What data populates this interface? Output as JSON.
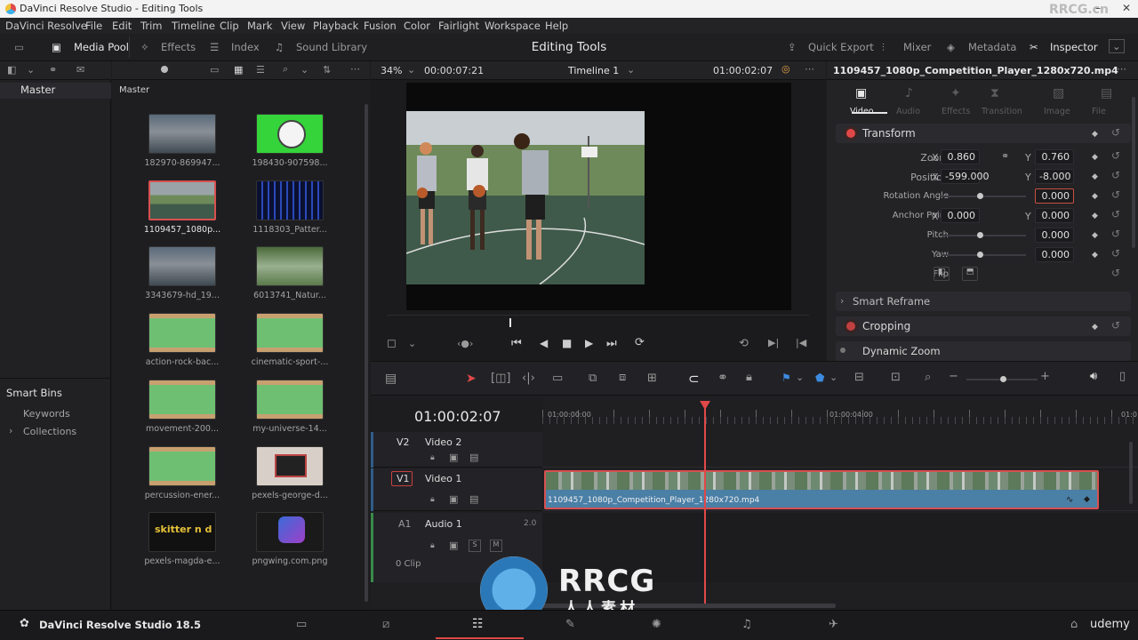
{
  "window": {
    "title": "DaVinci Resolve Studio - Editing Tools",
    "watermark": "RRCG.cn"
  },
  "menu": [
    "DaVinci Resolve",
    "File",
    "Edit",
    "Trim",
    "Timeline",
    "Clip",
    "Mark",
    "View",
    "Playback",
    "Fusion",
    "Color",
    "Fairlight",
    "Workspace",
    "Help"
  ],
  "toolbar": {
    "media_pool": "Media Pool",
    "effects": "Effects",
    "index": "Index",
    "sound_library": "Sound Library",
    "page_title": "Editing Tools",
    "quick_export": "Quick Export",
    "mixer": "Mixer",
    "metadata": "Metadata",
    "inspector": "Inspector"
  },
  "bins": {
    "master": "Master",
    "smart_bins": "Smart Bins",
    "keywords": "Keywords",
    "collections": "Collections"
  },
  "pool": {
    "header": "Master",
    "clips": [
      {
        "name": "182970-869947...",
        "kind": "video"
      },
      {
        "name": "198430-907598...",
        "kind": "green"
      },
      {
        "name": "1109457_1080p...",
        "kind": "selected"
      },
      {
        "name": "1118303_Patter...",
        "kind": "blue"
      },
      {
        "name": "3343679-hd_19...",
        "kind": "video"
      },
      {
        "name": "6013741_Natur...",
        "kind": "nature"
      },
      {
        "name": "action-rock-bac...",
        "kind": "audio"
      },
      {
        "name": "cinematic-sport-...",
        "kind": "audio"
      },
      {
        "name": "movement-200...",
        "kind": "audio"
      },
      {
        "name": "my-universe-14...",
        "kind": "audio"
      },
      {
        "name": "percussion-ener...",
        "kind": "audio"
      },
      {
        "name": "pexels-george-d...",
        "kind": "image"
      },
      {
        "name": "pexels-magda-e...",
        "kind": "dark"
      },
      {
        "name": "pngwing.com.png",
        "kind": "resolve"
      }
    ],
    "thumb_text": "skitter n d"
  },
  "viewer": {
    "zoom": "34%",
    "source_tc": "00:00:07:21",
    "timeline_name": "Timeline 1",
    "record_tc": "01:00:02:07"
  },
  "inspector": {
    "clip_name": "1109457_1080p_Competition_Player_1280x720.mp4",
    "tabs": [
      "Video",
      "Audio",
      "Effects",
      "Transition",
      "Image",
      "File"
    ],
    "transform": "Transform",
    "zoom_label": "Zoom",
    "zoom_x": "0.860",
    "zoom_y": "0.760",
    "position_label": "Position",
    "pos_x": "-599.000",
    "pos_y": "-8.000",
    "rotation_label": "Rotation Angle",
    "rotation": "0.000",
    "anchor_label": "Anchor Point",
    "anchor_x": "0.000",
    "anchor_y": "0.000",
    "pitch_label": "Pitch",
    "pitch": "0.000",
    "yaw_label": "Yaw",
    "yaw": "0.000",
    "flip_label": "Flip",
    "x": "X",
    "y": "Y",
    "smart_reframe": "Smart Reframe",
    "cropping": "Cropping",
    "dynamic_zoom": "Dynamic Zoom"
  },
  "timeline": {
    "timecode": "01:00:02:07",
    "ruler": [
      "01:00:00:00",
      "01:00:04:00",
      "01:0"
    ],
    "tracks": {
      "v2": {
        "id": "V2",
        "name": "Video 2"
      },
      "v1": {
        "id": "V1",
        "name": "Video 1"
      },
      "a1": {
        "id": "A1",
        "name": "Audio 1",
        "ch": "2.0",
        "clips": "0 Clip"
      }
    },
    "clip_label": "1109457_1080p_Competition_Player_1280x720.mp4",
    "s": "S",
    "m": "M"
  },
  "footer": {
    "app": "DaVinci Resolve Studio 18.5",
    "brand": "udemy",
    "watermark_big": "RRCG",
    "watermark_sub": "人人素材"
  }
}
